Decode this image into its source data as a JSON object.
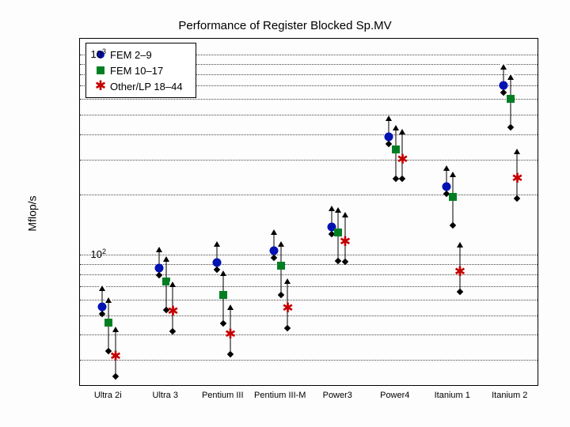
{
  "chart_data": {
    "type": "scatter",
    "title": "Performance of Register Blocked Sp.MV",
    "xlabel": "",
    "ylabel": "Mflop/s",
    "yscale": "log",
    "ylim": [
      22,
      1200
    ],
    "yticks": [
      {
        "value": 100,
        "label_html": "10<sup>2</sup>"
      },
      {
        "value": 1000,
        "label_html": "10<sup>3</sup>"
      }
    ],
    "categories": [
      "Ultra 2i",
      "Ultra 3",
      "Pentium III",
      "Pentium III-M",
      "Power3",
      "Power4",
      "Itanium 1",
      "Itanium 2"
    ],
    "series": [
      {
        "name": "FEM 2–9",
        "marker": "circle",
        "values": [
          55,
          86,
          92,
          105,
          138,
          390,
          220,
          700
        ]
      },
      {
        "name": "FEM 10–17",
        "marker": "square",
        "values": [
          46,
          74,
          63,
          88,
          130,
          335,
          195,
          600
        ]
      },
      {
        "name": "Other/LP 18–44",
        "marker": "asterisk",
        "values": [
          31,
          52,
          40,
          54,
          116,
          300,
          82,
          240
        ]
      }
    ],
    "range_bars": {
      "circle": {
        "hi_mult": 1.2,
        "lo_mult": 0.92
      },
      "square": {
        "hi_mult": 1.25,
        "lo_mult": 0.72
      },
      "asterisk": {
        "hi_mult": 1.33,
        "lo_mult": 0.8
      }
    },
    "series_x_offset": {
      "circle": -0.12,
      "square": 0.0,
      "asterisk": 0.12
    },
    "legend_position": "top-left"
  }
}
